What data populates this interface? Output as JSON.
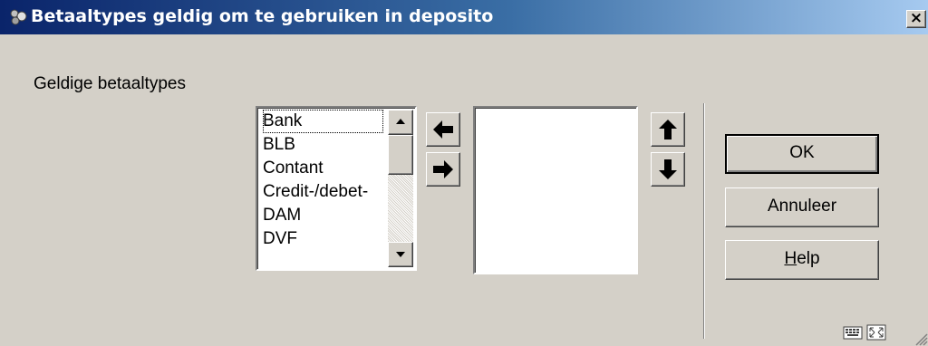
{
  "window": {
    "title": "Betaaltypes geldig om te gebruiken in deposito",
    "close_label": "×"
  },
  "form": {
    "field_label": "Geldige betaaltypes",
    "available_list": [
      "Bank",
      "BLB",
      "Contant",
      "Credit-/debet-",
      "DAM",
      "DVF"
    ],
    "selected_list": []
  },
  "buttons": {
    "ok": "OK",
    "cancel": "Annuleer",
    "help_mnemonic": "H",
    "help_rest": "elp"
  },
  "icons": {
    "title": "app-icon",
    "move_left": "arrow-left-icon",
    "move_right": "arrow-right-icon",
    "move_up": "arrow-up-icon",
    "move_down": "arrow-down-icon",
    "status_1": "keyboard-icon",
    "status_2": "resize-icon"
  },
  "colors": {
    "titlebar_start": "#0a246a",
    "titlebar_end": "#a6caf0",
    "dialog_bg": "#d4d0c8"
  }
}
